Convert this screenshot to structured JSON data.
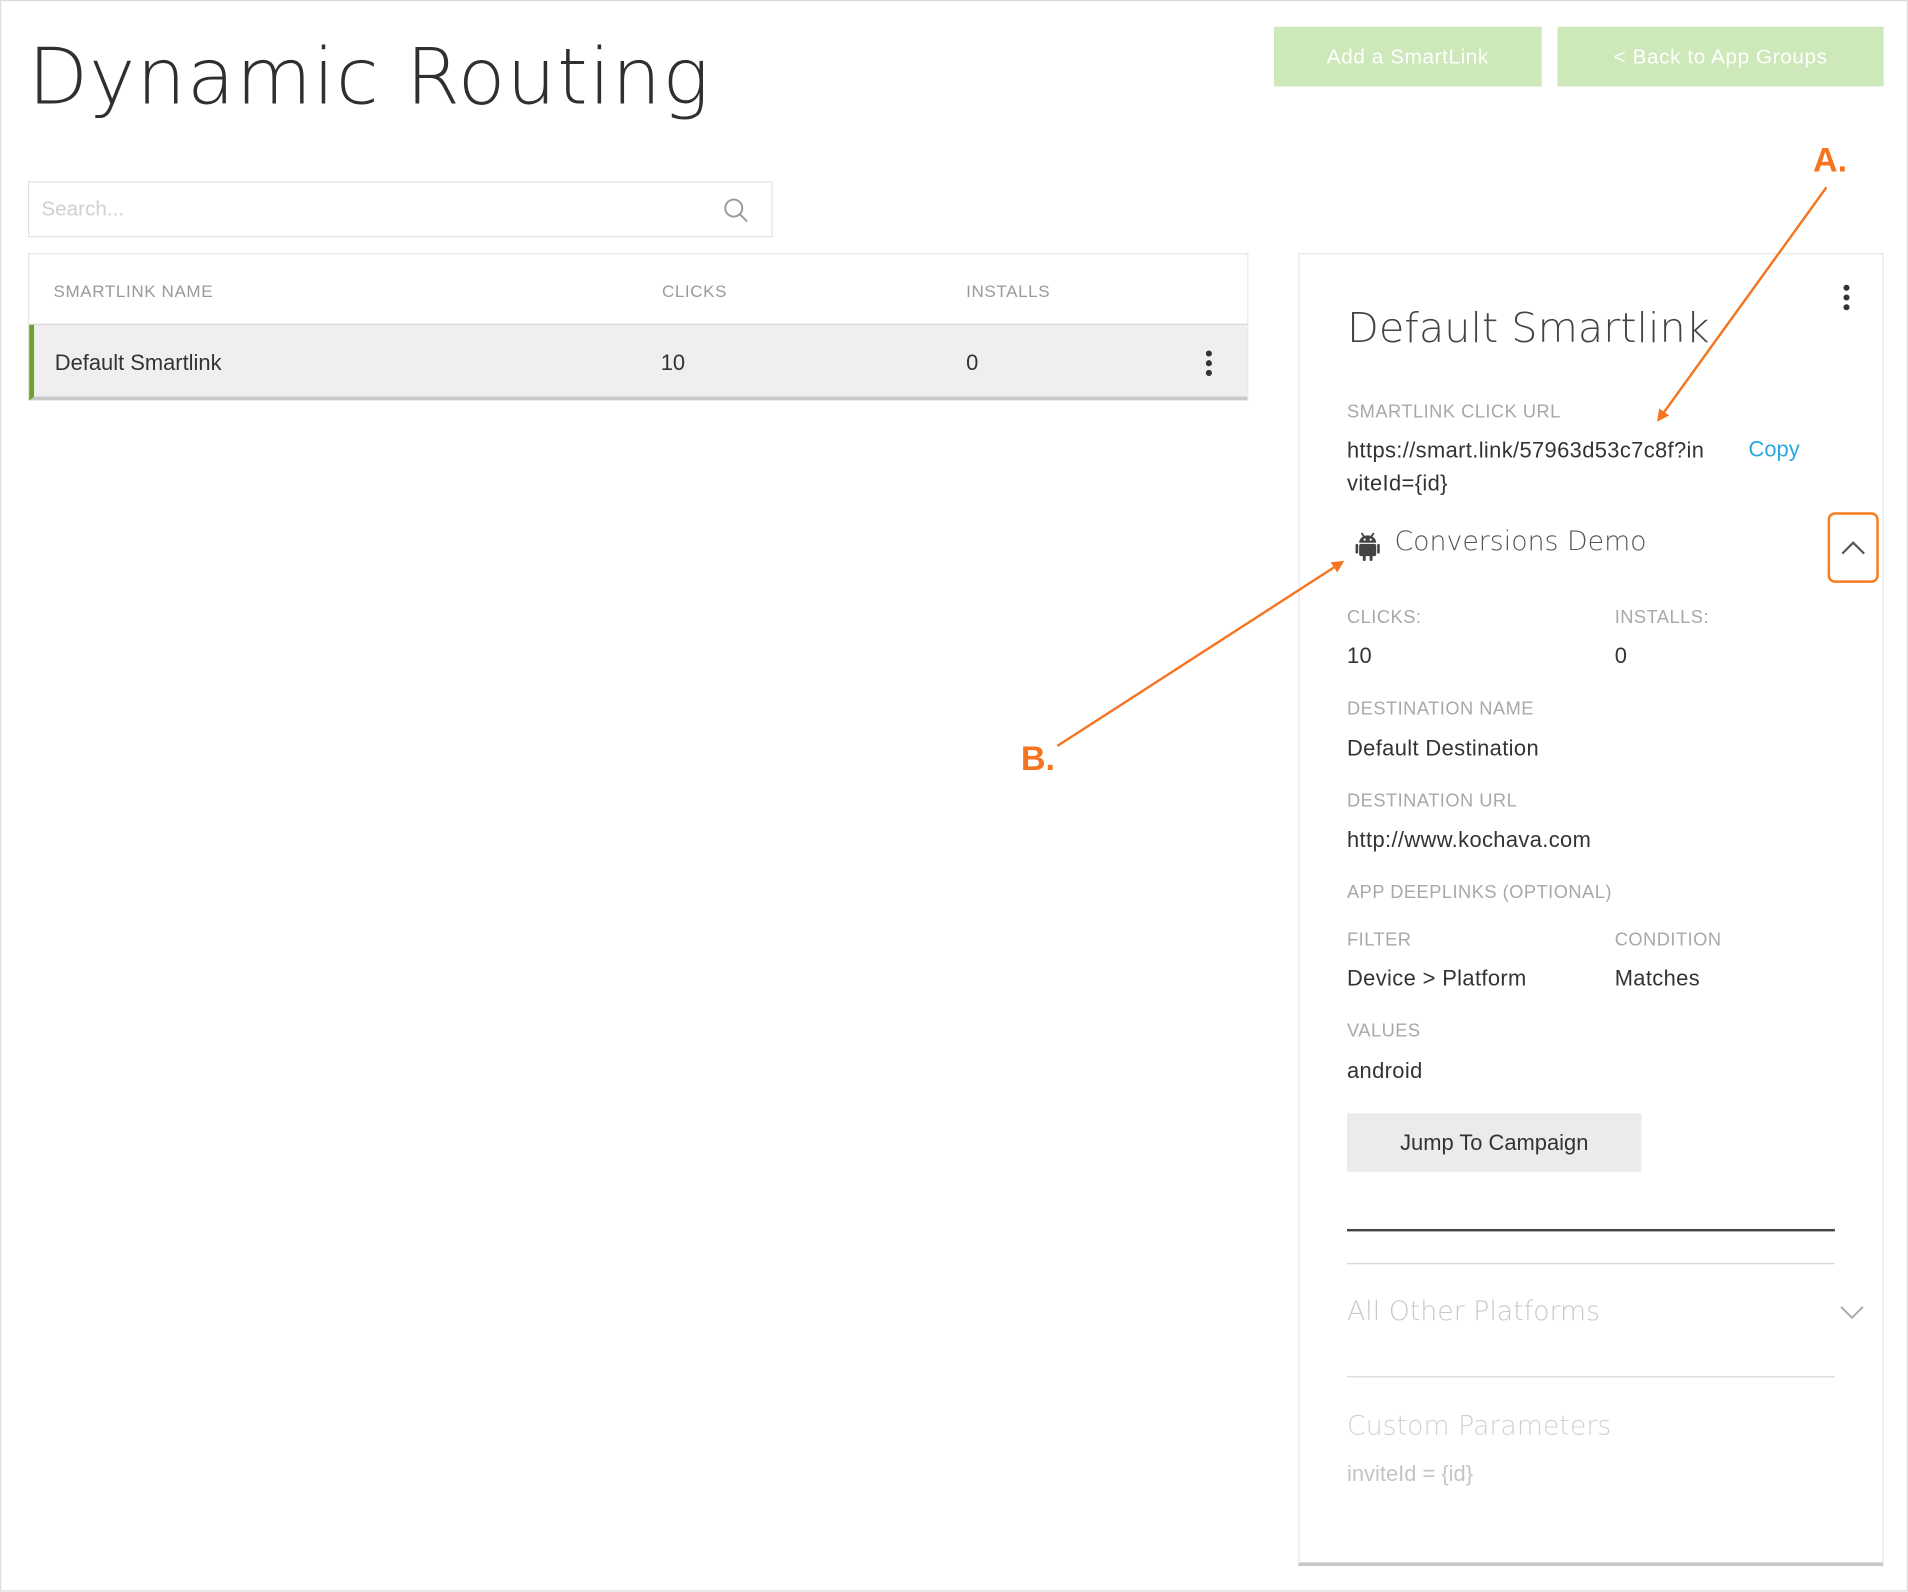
{
  "page": {
    "title": "Dynamic Routing"
  },
  "header": {
    "add_smartlink": "Add a SmartLink",
    "back_to_groups": "< Back to App Groups"
  },
  "search": {
    "placeholder": "Search..."
  },
  "table": {
    "columns": [
      "SMARTLINK NAME",
      "CLICKS",
      "INSTALLS"
    ],
    "rows": [
      {
        "name": "Default Smartlink",
        "clicks": "10",
        "installs": "0"
      }
    ]
  },
  "detail": {
    "title": "Default Smartlink",
    "click_url_label": "SMARTLINK CLICK URL",
    "click_url": "https://smart.link/57963d53c7c8f?inviteId={id}",
    "copy_label": "Copy",
    "platform_section": {
      "name": "Conversions Demo",
      "platform_icon": "android-icon",
      "clicks_label": "CLICKS:",
      "clicks": "10",
      "installs_label": "INSTALLS:",
      "installs": "0",
      "destination_name_label": "DESTINATION NAME",
      "destination_name": "Default Destination",
      "destination_url_label": "DESTINATION URL",
      "destination_url": "http://www.kochava.com",
      "deeplinks_label": "APP DEEPLINKS (OPTIONAL)",
      "filter_label": "FILTER",
      "filter": "Device > Platform",
      "condition_label": "CONDITION",
      "condition": "Matches",
      "values_label": "VALUES",
      "values": "android",
      "jump_button": "Jump To Campaign"
    },
    "other_platforms": "All Other Platforms",
    "custom_params": {
      "label": "Custom Parameters",
      "value": "inviteId = {id}"
    }
  },
  "annotations": {
    "a": "A.",
    "b": "B."
  },
  "colors": {
    "accent_green": "#6aa32b",
    "button_green": "#cde8b9",
    "link_blue": "#29a8df",
    "annotation_orange": "#f5741f"
  }
}
